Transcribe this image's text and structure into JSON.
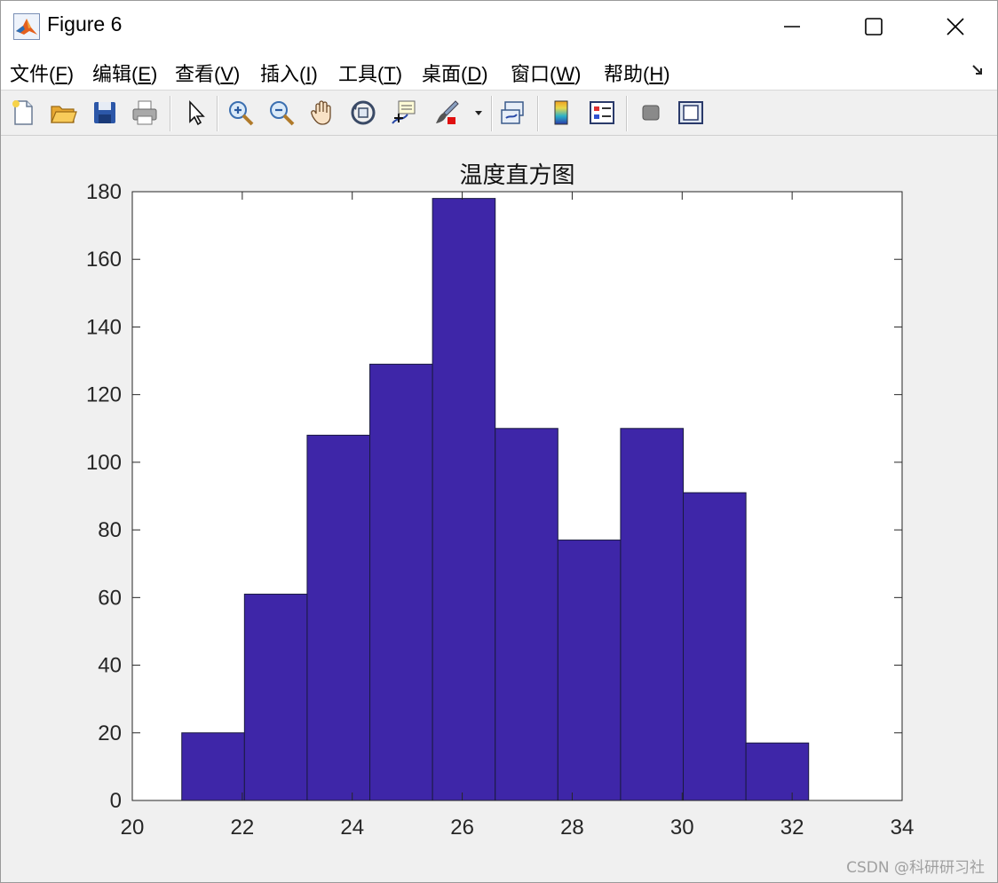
{
  "window": {
    "title": "Figure 6"
  },
  "menu": [
    {
      "label": "文件(",
      "key": "F",
      "end": ")"
    },
    {
      "label": "编辑(",
      "key": "E",
      "end": ")"
    },
    {
      "label": "查看(",
      "key": "V",
      "end": ")"
    },
    {
      "label": "插入(",
      "key": "I",
      "end": ")"
    },
    {
      "label": "工具(",
      "key": "T",
      "end": ")"
    },
    {
      "label": "桌面(",
      "key": "D",
      "end": ")"
    },
    {
      "label": "窗口(",
      "key": "W",
      "end": ")"
    },
    {
      "label": "帮助(",
      "key": "H",
      "end": ")"
    }
  ],
  "toolbar_icons": [
    "new-file-icon",
    "open-folder-icon",
    "save-icon",
    "print-icon",
    "pointer-icon",
    "zoom-in-icon",
    "zoom-out-icon",
    "pan-hand-icon",
    "rotate-3d-icon",
    "data-cursor-icon",
    "brush-icon",
    "brush-dropdown-icon",
    "link-plot-icon",
    "colorbar-icon",
    "legend-icon",
    "hide-plot-tools-icon",
    "show-plot-tools-icon"
  ],
  "watermark": "CSDN @科研研习社",
  "colors": {
    "bar_fill": "#3e26a8",
    "bar_edge": "#1a1a40",
    "axes_bg": "#ffffff",
    "figure_bg": "#f0f0f0"
  },
  "chart_data": {
    "type": "bar",
    "title": "温度直方图",
    "xlabel": "",
    "ylabel": "",
    "xlim": [
      20,
      34
    ],
    "ylim": [
      0,
      180
    ],
    "xticks": [
      20,
      22,
      24,
      26,
      28,
      30,
      32,
      34
    ],
    "yticks": [
      0,
      20,
      40,
      60,
      80,
      100,
      120,
      140,
      160,
      180
    ],
    "bin_edges": [
      20.9,
      22.04,
      23.18,
      24.32,
      25.46,
      26.6,
      27.74,
      28.88,
      30.02,
      31.16,
      32.3
    ],
    "values": [
      20,
      61,
      108,
      129,
      178,
      110,
      77,
      110,
      91,
      17
    ],
    "grid": false
  }
}
